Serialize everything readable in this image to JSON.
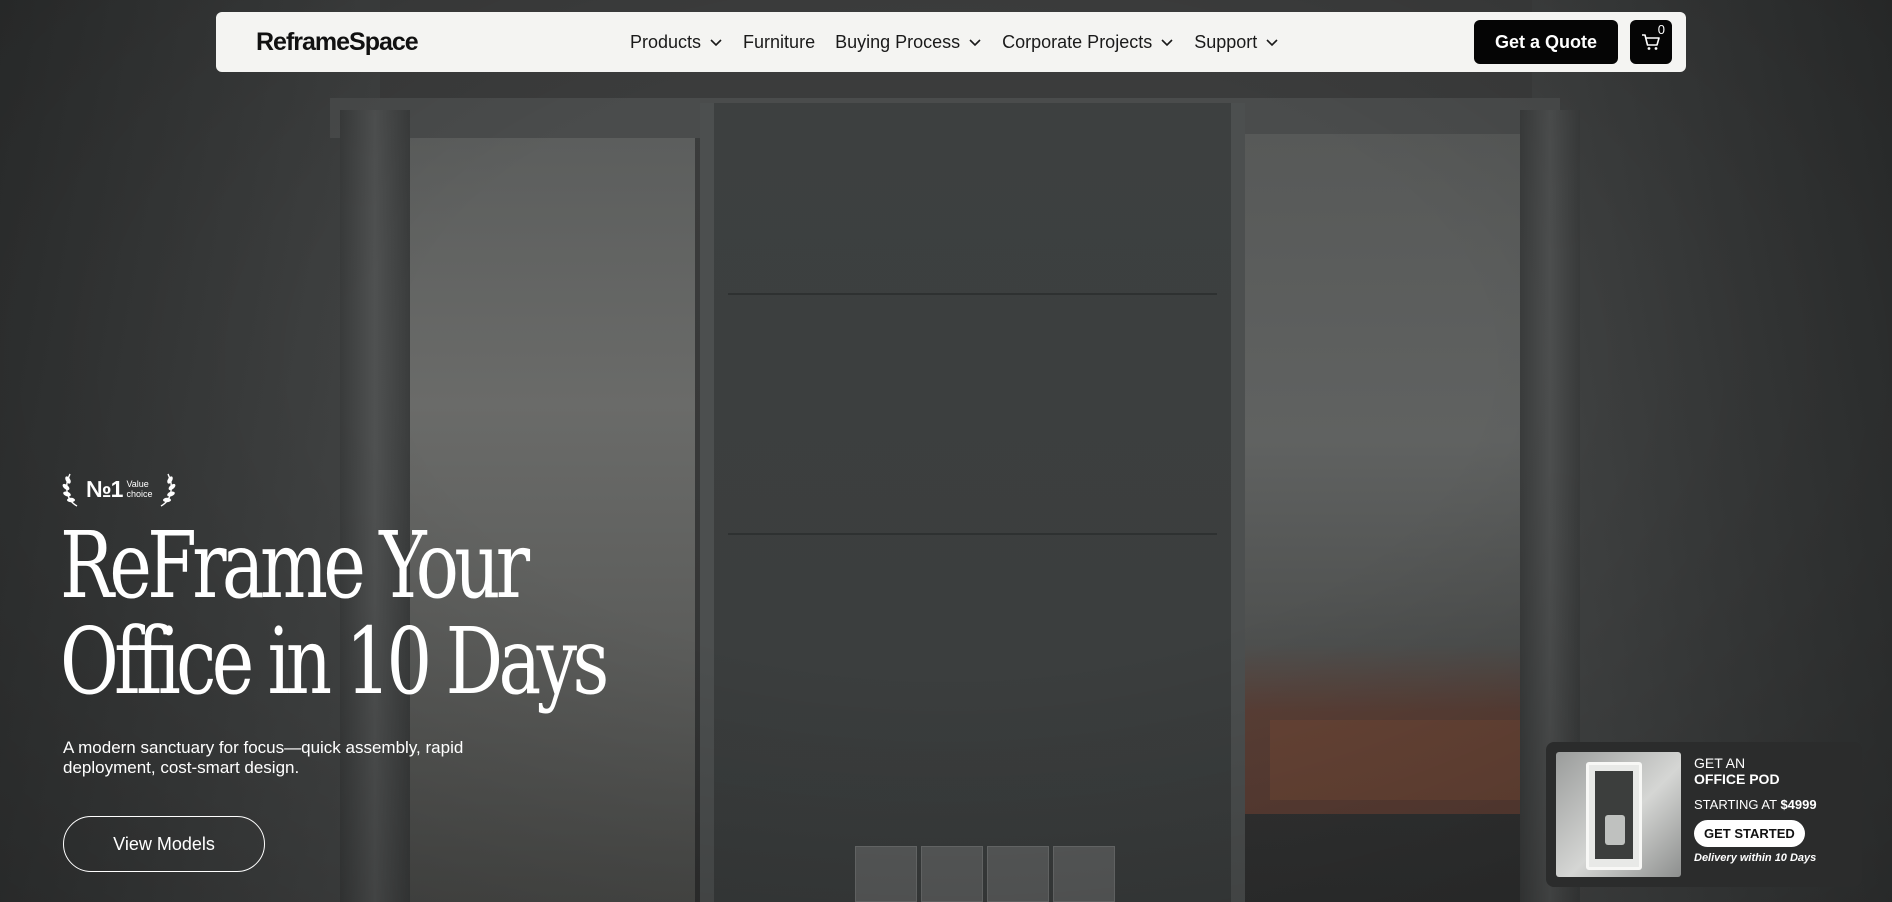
{
  "header": {
    "logo": "ReframeSpace",
    "nav": [
      {
        "label": "Products",
        "has_dropdown": true
      },
      {
        "label": "Furniture",
        "has_dropdown": false
      },
      {
        "label": "Buying Process",
        "has_dropdown": true
      },
      {
        "label": "Corporate Projects",
        "has_dropdown": true
      },
      {
        "label": "Support",
        "has_dropdown": true
      }
    ],
    "quote_label": "Get a Quote",
    "cart_count": "0",
    "cart_icon": "cart-icon"
  },
  "hero": {
    "badge": {
      "rank": "№1",
      "text_line1": "Value",
      "text_line2": "choice",
      "icon": "laurel-icon"
    },
    "title_line1": "ReFrame Your",
    "title_line2": "Office in 10 Days",
    "subtitle": "A modern sanctuary for focus—quick assembly, rapid deployment, cost-smart design.",
    "cta_label": "View Models"
  },
  "promo": {
    "line1": "GET AN",
    "line2": "OFFICE POD",
    "price_prefix": "STARTING AT ",
    "price": "$4999",
    "cta_label": "GET STARTED",
    "note": "Delivery within 10 Days"
  },
  "colors": {
    "nav_bg": "#f4f4f2",
    "button_dark": "#050505",
    "promo_bg": "#2b2c2c"
  }
}
